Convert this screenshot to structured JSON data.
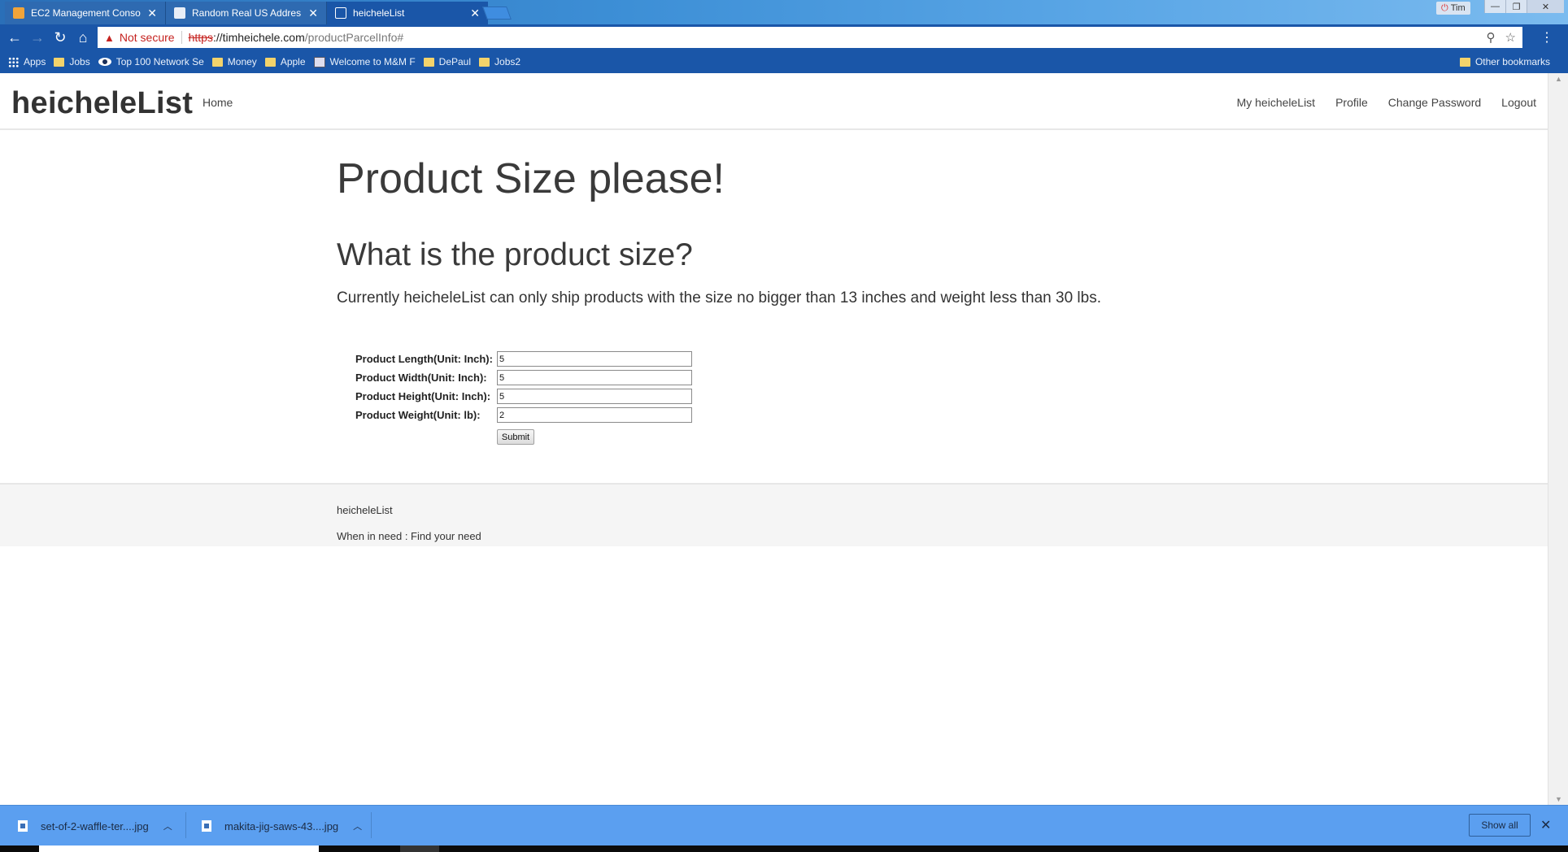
{
  "browser": {
    "tabs": [
      {
        "title": "EC2 Management Conso",
        "active": false,
        "favicon_color": "#f0a43a"
      },
      {
        "title": "Random Real US Addres",
        "active": false,
        "favicon_color": "#e8eef7"
      },
      {
        "title": "heicheleList",
        "active": true,
        "favicon_color": "#ffffff"
      }
    ],
    "window_user": "Tim",
    "address": {
      "security_label": "Not secure",
      "scheme": "https",
      "host": "://timheichele.com",
      "path": "/productParcelInfo#"
    },
    "bookmarks": [
      {
        "label": "Apps",
        "icon": "apps-grid-icon"
      },
      {
        "label": "Jobs",
        "icon": "folder-icon"
      },
      {
        "label": "Top 100 Network Se",
        "icon": "eye-icon"
      },
      {
        "label": "Money",
        "icon": "folder-icon"
      },
      {
        "label": "Apple",
        "icon": "folder-icon"
      },
      {
        "label": "Welcome to M&M F",
        "icon": "mm-icon"
      },
      {
        "label": "DePaul",
        "icon": "folder-icon"
      },
      {
        "label": "Jobs2",
        "icon": "folder-icon"
      }
    ],
    "other_bookmarks": "Other bookmarks"
  },
  "site": {
    "brand": "heicheleList",
    "nav_left": "Home",
    "nav_right": [
      "My heicheleList",
      "Profile",
      "Change Password",
      "Logout"
    ]
  },
  "main": {
    "title": "Product Size please!",
    "subtitle": "What is the product size?",
    "description": "Currently heicheleList can only ship products with the size no bigger than 13 inches and weight less than 30 lbs.",
    "form": {
      "fields": [
        {
          "label": "Product Length(Unit: Inch):",
          "value": "5"
        },
        {
          "label": "Product Width(Unit: Inch):",
          "value": "5"
        },
        {
          "label": "Product Height(Unit: Inch):",
          "value": "5"
        },
        {
          "label": "Product Weight(Unit: lb):",
          "value": "2"
        }
      ],
      "submit_label": "Submit"
    }
  },
  "footer": {
    "name": "heicheleList",
    "tagline": "When in need : Find your need"
  },
  "downloads": {
    "items": [
      "set-of-2-waffle-ter....jpg",
      "makita-jig-saws-43....jpg"
    ],
    "show_all": "Show all"
  }
}
